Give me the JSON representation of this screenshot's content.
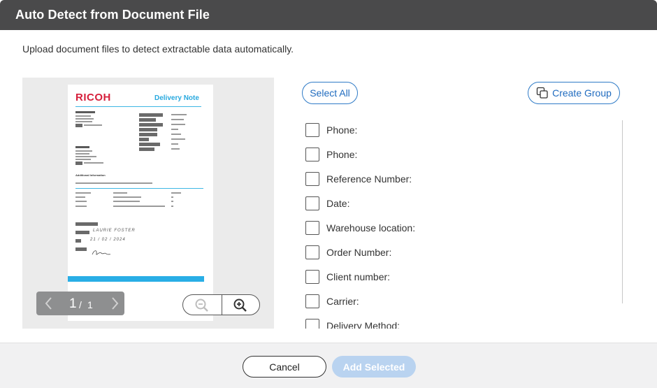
{
  "dialog": {
    "title": "Auto Detect from Document File",
    "subtitle": "Upload document files to detect extractable data automatically."
  },
  "preview": {
    "document": {
      "logo": "RICOH",
      "title": "Delivery Note",
      "section_heading": "Additional Information",
      "handwriting": [
        "LAURIE FOSTER",
        "21 / 02 / 2024"
      ],
      "colors": {
        "logo": "#d61f3b",
        "accent": "#29aee6"
      }
    },
    "pager": {
      "current": "1",
      "separator": "/",
      "total": "1"
    },
    "icons": {
      "prev": "chevron-left-icon",
      "next": "chevron-right-icon",
      "zoom_out": "zoom-out-icon",
      "zoom_in": "zoom-in-icon"
    }
  },
  "actions": {
    "select_all": "Select All",
    "create_group": "Create Group",
    "create_group_icon": "copy-icon"
  },
  "fields": [
    {
      "label": "Phone:",
      "checked": false
    },
    {
      "label": "Phone:",
      "checked": false
    },
    {
      "label": "Reference Number:",
      "checked": false
    },
    {
      "label": "Date:",
      "checked": false
    },
    {
      "label": "Warehouse location:",
      "checked": false
    },
    {
      "label": "Order Number:",
      "checked": false
    },
    {
      "label": "Client number:",
      "checked": false
    },
    {
      "label": "Carrier:",
      "checked": false
    },
    {
      "label": "Delivery Method:",
      "checked": false
    }
  ],
  "footer": {
    "cancel": "Cancel",
    "add_selected": "Add Selected",
    "colors": {
      "primary_disabled": "#b9d3f0",
      "accent": "#1f6bbf"
    }
  }
}
